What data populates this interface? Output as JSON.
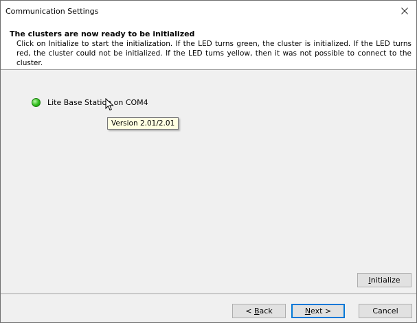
{
  "window": {
    "title": "Communication Settings",
    "close_icon": "close-icon"
  },
  "header": {
    "title": "The clusters are now ready to be initialized",
    "description": "Click on Initialize to start the initialization. If the LED turns green, the cluster is initialized. If the LED turns red, the cluster could not be initialized. If the LED turns yellow, then it was not possible to connect to the cluster."
  },
  "cluster": {
    "label": "Lite Base Station on COM4",
    "led_status": "green",
    "led_color": "#2fbd1a",
    "tooltip": "Version 2.01/2.01"
  },
  "buttons": {
    "initialize": {
      "pre": "",
      "accel": "I",
      "post": "nitialize"
    },
    "back": {
      "pre": "< ",
      "accel": "B",
      "post": "ack"
    },
    "next": {
      "pre": "",
      "accel": "N",
      "post": "ext >"
    },
    "cancel": "Cancel"
  }
}
